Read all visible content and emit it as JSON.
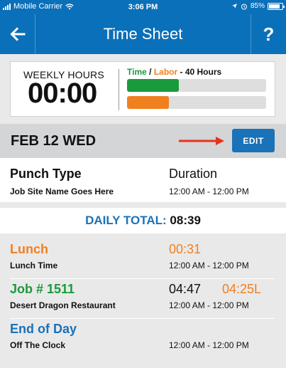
{
  "status_bar": {
    "carrier": "Mobile Carrier",
    "time": "3:06 PM",
    "battery": "85%"
  },
  "navbar": {
    "title": "Time Sheet",
    "help_label": "?",
    "back_icon": "arrow-left-icon"
  },
  "summary": {
    "weekly_label": "WEEKLY HOURS",
    "weekly_value": "00:00",
    "legend_time": "Time",
    "legend_sep": " / ",
    "legend_labor": "Labor",
    "legend_hours": " - 40 Hours",
    "time_fraction": 0.37,
    "labor_fraction": 0.3,
    "colors": {
      "time": "#1a9a3c",
      "labor": "#f0801e"
    }
  },
  "date_bar": {
    "date": "FEB 12 WED",
    "edit_label": "EDIT",
    "arrow_color": "#e8321f"
  },
  "header": {
    "col1_title": "Punch Type",
    "col1_sub": "Job Site Name Goes Here",
    "col2_title": "Duration",
    "col2_sub": "12:00 AM - 12:00 PM"
  },
  "daily_total": {
    "label": "DAILY TOTAL:",
    "value": "08:39"
  },
  "entries": [
    {
      "title": "Lunch",
      "sub": "Lunch Time",
      "duration": "00:31",
      "duration2": "",
      "range": "12:00 AM - 12:00 PM"
    },
    {
      "title": "Job # 1511",
      "sub": "Desert Dragon Restaurant",
      "duration": "04:47",
      "duration2": "04:25L",
      "range": "12:00 AM - 12:00 PM"
    },
    {
      "title": "End of Day",
      "sub": "Off The Clock",
      "duration": "",
      "duration2": "",
      "range": "12:00 AM - 12:00 PM"
    }
  ]
}
